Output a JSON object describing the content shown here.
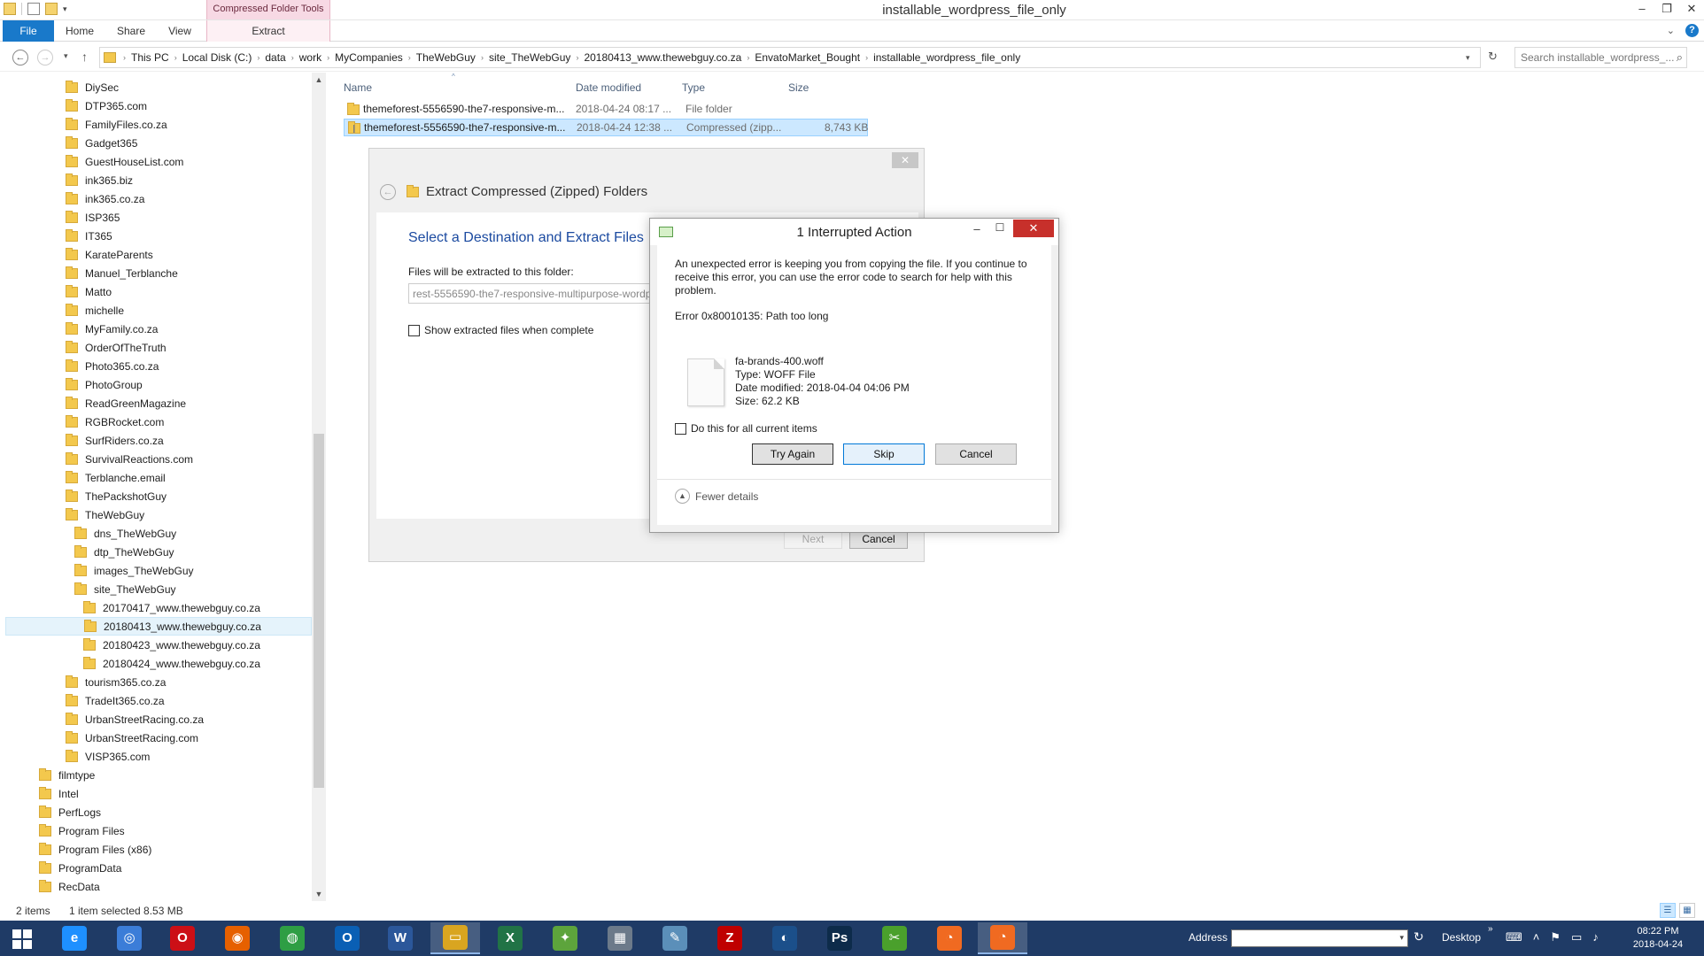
{
  "window": {
    "title": "installable_wordpress_file_only",
    "context_tab_title": "Compressed Folder Tools"
  },
  "ribbon": {
    "tabs": [
      "File",
      "Home",
      "Share",
      "View"
    ],
    "extract_tab": "Extract"
  },
  "address": {
    "crumbs": [
      "This PC",
      "Local Disk (C:)",
      "data",
      "work",
      "MyCompanies",
      "TheWebGuy",
      "site_TheWebGuy",
      "20180413_www.thewebguy.co.za",
      "EnvatoMarket_Bought",
      "installable_wordpress_file_only"
    ],
    "search_placeholder": "Search installable_wordpress_..."
  },
  "tree": [
    {
      "label": "DiySec",
      "level": 2
    },
    {
      "label": "DTP365.com",
      "level": 2
    },
    {
      "label": "FamilyFiles.co.za",
      "level": 2
    },
    {
      "label": "Gadget365",
      "level": 2
    },
    {
      "label": "GuestHouseList.com",
      "level": 2
    },
    {
      "label": "ink365.biz",
      "level": 2
    },
    {
      "label": "ink365.co.za",
      "level": 2
    },
    {
      "label": "ISP365",
      "level": 2
    },
    {
      "label": "IT365",
      "level": 2
    },
    {
      "label": "KarateParents",
      "level": 2
    },
    {
      "label": "Manuel_Terblanche",
      "level": 2
    },
    {
      "label": "Matto",
      "level": 2
    },
    {
      "label": "michelle",
      "level": 2
    },
    {
      "label": "MyFamily.co.za",
      "level": 2
    },
    {
      "label": "OrderOfTheTruth",
      "level": 2
    },
    {
      "label": "Photo365.co.za",
      "level": 2
    },
    {
      "label": "PhotoGroup",
      "level": 2
    },
    {
      "label": "ReadGreenMagazine",
      "level": 2
    },
    {
      "label": "RGBRocket.com",
      "level": 2
    },
    {
      "label": "SurfRiders.co.za",
      "level": 2
    },
    {
      "label": "SurvivalReactions.com",
      "level": 2
    },
    {
      "label": "Terblanche.email",
      "level": 2
    },
    {
      "label": "ThePackshotGuy",
      "level": 2
    },
    {
      "label": "TheWebGuy",
      "level": 2
    },
    {
      "label": "dns_TheWebGuy",
      "level": 3
    },
    {
      "label": "dtp_TheWebGuy",
      "level": 3
    },
    {
      "label": "images_TheWebGuy",
      "level": 3
    },
    {
      "label": "site_TheWebGuy",
      "level": 3
    },
    {
      "label": "20170417_www.thewebguy.co.za",
      "level": 4
    },
    {
      "label": "20180413_www.thewebguy.co.za",
      "level": 4,
      "selected": true
    },
    {
      "label": "20180423_www.thewebguy.co.za",
      "level": 4
    },
    {
      "label": "20180424_www.thewebguy.co.za",
      "level": 4
    },
    {
      "label": "tourism365.co.za",
      "level": 2
    },
    {
      "label": "TradeIt365.co.za",
      "level": 2
    },
    {
      "label": "UrbanStreetRacing.co.za",
      "level": 2
    },
    {
      "label": "UrbanStreetRacing.com",
      "level": 2
    },
    {
      "label": "VISP365.com",
      "level": 2
    },
    {
      "label": "filmtype",
      "level": 1
    },
    {
      "label": "Intel",
      "level": 1
    },
    {
      "label": "PerfLogs",
      "level": 1
    },
    {
      "label": "Program Files",
      "level": 1
    },
    {
      "label": "Program Files (x86)",
      "level": 1
    },
    {
      "label": "ProgramData",
      "level": 1
    },
    {
      "label": "RecData",
      "level": 1
    }
  ],
  "filelist": {
    "columns": {
      "name": "Name",
      "date": "Date modified",
      "type": "Type",
      "size": "Size"
    },
    "files": [
      {
        "name": "themeforest-5556590-the7-responsive-m...",
        "date": "2018-04-24 08:17 ...",
        "type": "File folder",
        "size": "",
        "kind": "folder",
        "selected": false
      },
      {
        "name": "themeforest-5556590-the7-responsive-m...",
        "date": "2018-04-24 12:38 ...",
        "type": "Compressed (zipp...",
        "size": "8,743 KB",
        "kind": "zip",
        "selected": true
      }
    ]
  },
  "wizard": {
    "title": "Extract Compressed (Zipped) Folders",
    "heading": "Select a Destination and Extract Files",
    "path_label": "Files will be extracted to this folder:",
    "path_value": "rest-5556590-the7-responsive-multipurpose-wordp",
    "show_files_label": "Show extracted files when complete",
    "next_label": "Next",
    "cancel_label": "Cancel"
  },
  "dialog": {
    "title": "1 Interrupted Action",
    "message": "An unexpected error is keeping you from copying the file. If you continue to receive this error, you can use the error code to search for help with this problem.",
    "error": "Error 0x80010135: Path too long",
    "file": {
      "name": "fa-brands-400.woff",
      "type": "Type: WOFF File",
      "modified": "Date modified: 2018-04-04 04:06 PM",
      "size": "Size: 62.2 KB"
    },
    "do_all_label": "Do this for all current items",
    "try_again_label": "Try Again",
    "skip_label": "Skip",
    "cancel_label": "Cancel",
    "fewer_details_label": "Fewer details"
  },
  "status": {
    "count": "2 items",
    "selection": "1 item selected  8.53 MB"
  },
  "taskbar": {
    "apps": [
      {
        "name": "internet-explorer",
        "glyph": "e",
        "color": "#1e90ff"
      },
      {
        "name": "safari",
        "glyph": "◎",
        "color": "#3b7dd8"
      },
      {
        "name": "opera",
        "glyph": "O",
        "color": "#cc0f16"
      },
      {
        "name": "firefox",
        "glyph": "◉",
        "color": "#e66000"
      },
      {
        "name": "chrome",
        "glyph": "◍",
        "color": "#2e9e44"
      },
      {
        "name": "outlook",
        "glyph": "O",
        "color": "#0a5fb4"
      },
      {
        "name": "word",
        "glyph": "W",
        "color": "#2b579a"
      },
      {
        "name": "file-explorer",
        "glyph": "▭",
        "color": "#d9a520",
        "active": true
      },
      {
        "name": "excel",
        "glyph": "X",
        "color": "#217346"
      },
      {
        "name": "games",
        "glyph": "✦",
        "color": "#5da43c"
      },
      {
        "name": "calculator",
        "glyph": "▦",
        "color": "#6c7a8a"
      },
      {
        "name": "notepad",
        "glyph": "✎",
        "color": "#5b8fb9"
      },
      {
        "name": "filezilla",
        "glyph": "Z",
        "color": "#bf0000"
      },
      {
        "name": "media-player",
        "glyph": "◐",
        "color": "#1b4f8a"
      },
      {
        "name": "photoshop",
        "glyph": "Ps",
        "color": "#0d2b4a"
      },
      {
        "name": "greenshot",
        "glyph": "✂",
        "color": "#4aa02c"
      },
      {
        "name": "app-orange-1",
        "glyph": "◔",
        "color": "#f06a21"
      },
      {
        "name": "app-orange-2",
        "glyph": "◔",
        "color": "#f06a21",
        "active": true
      }
    ],
    "address_label": "Address",
    "desktop_label": "Desktop",
    "time": "08:22 PM",
    "date": "2018-04-24"
  }
}
